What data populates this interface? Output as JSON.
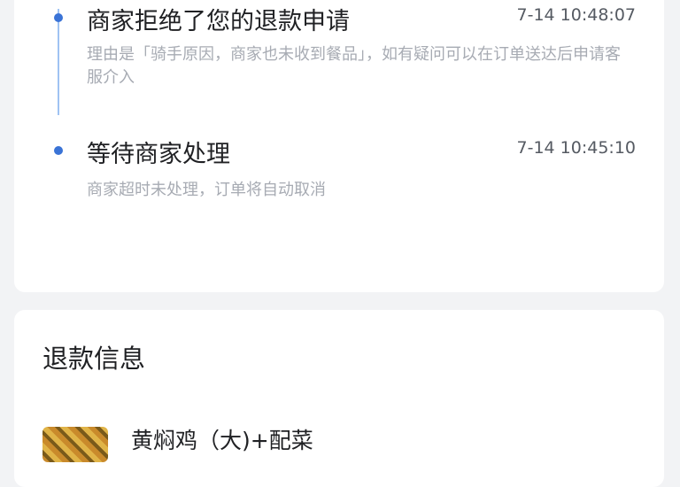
{
  "timeline": {
    "events": [
      {
        "title": "商家拒绝了您的退款申请",
        "time": "7-14 10:48:07",
        "description": "理由是「骑手原因，商家也未收到餐品」，如有疑问可以在订单送达后申请客服介入"
      },
      {
        "title": "等待商家处理",
        "time": "7-14 10:45:10",
        "description": "商家超时未处理，订单将自动取消"
      }
    ]
  },
  "refund_info": {
    "title": "退款信息",
    "items": [
      {
        "name": "黄焖鸡（大)+配菜",
        "thumbnail_icon": "food-thumbnail"
      }
    ]
  },
  "colors": {
    "accent": "#3a73d6",
    "timeline_line": "#9fc3f3",
    "background": "#f2f3f5"
  }
}
